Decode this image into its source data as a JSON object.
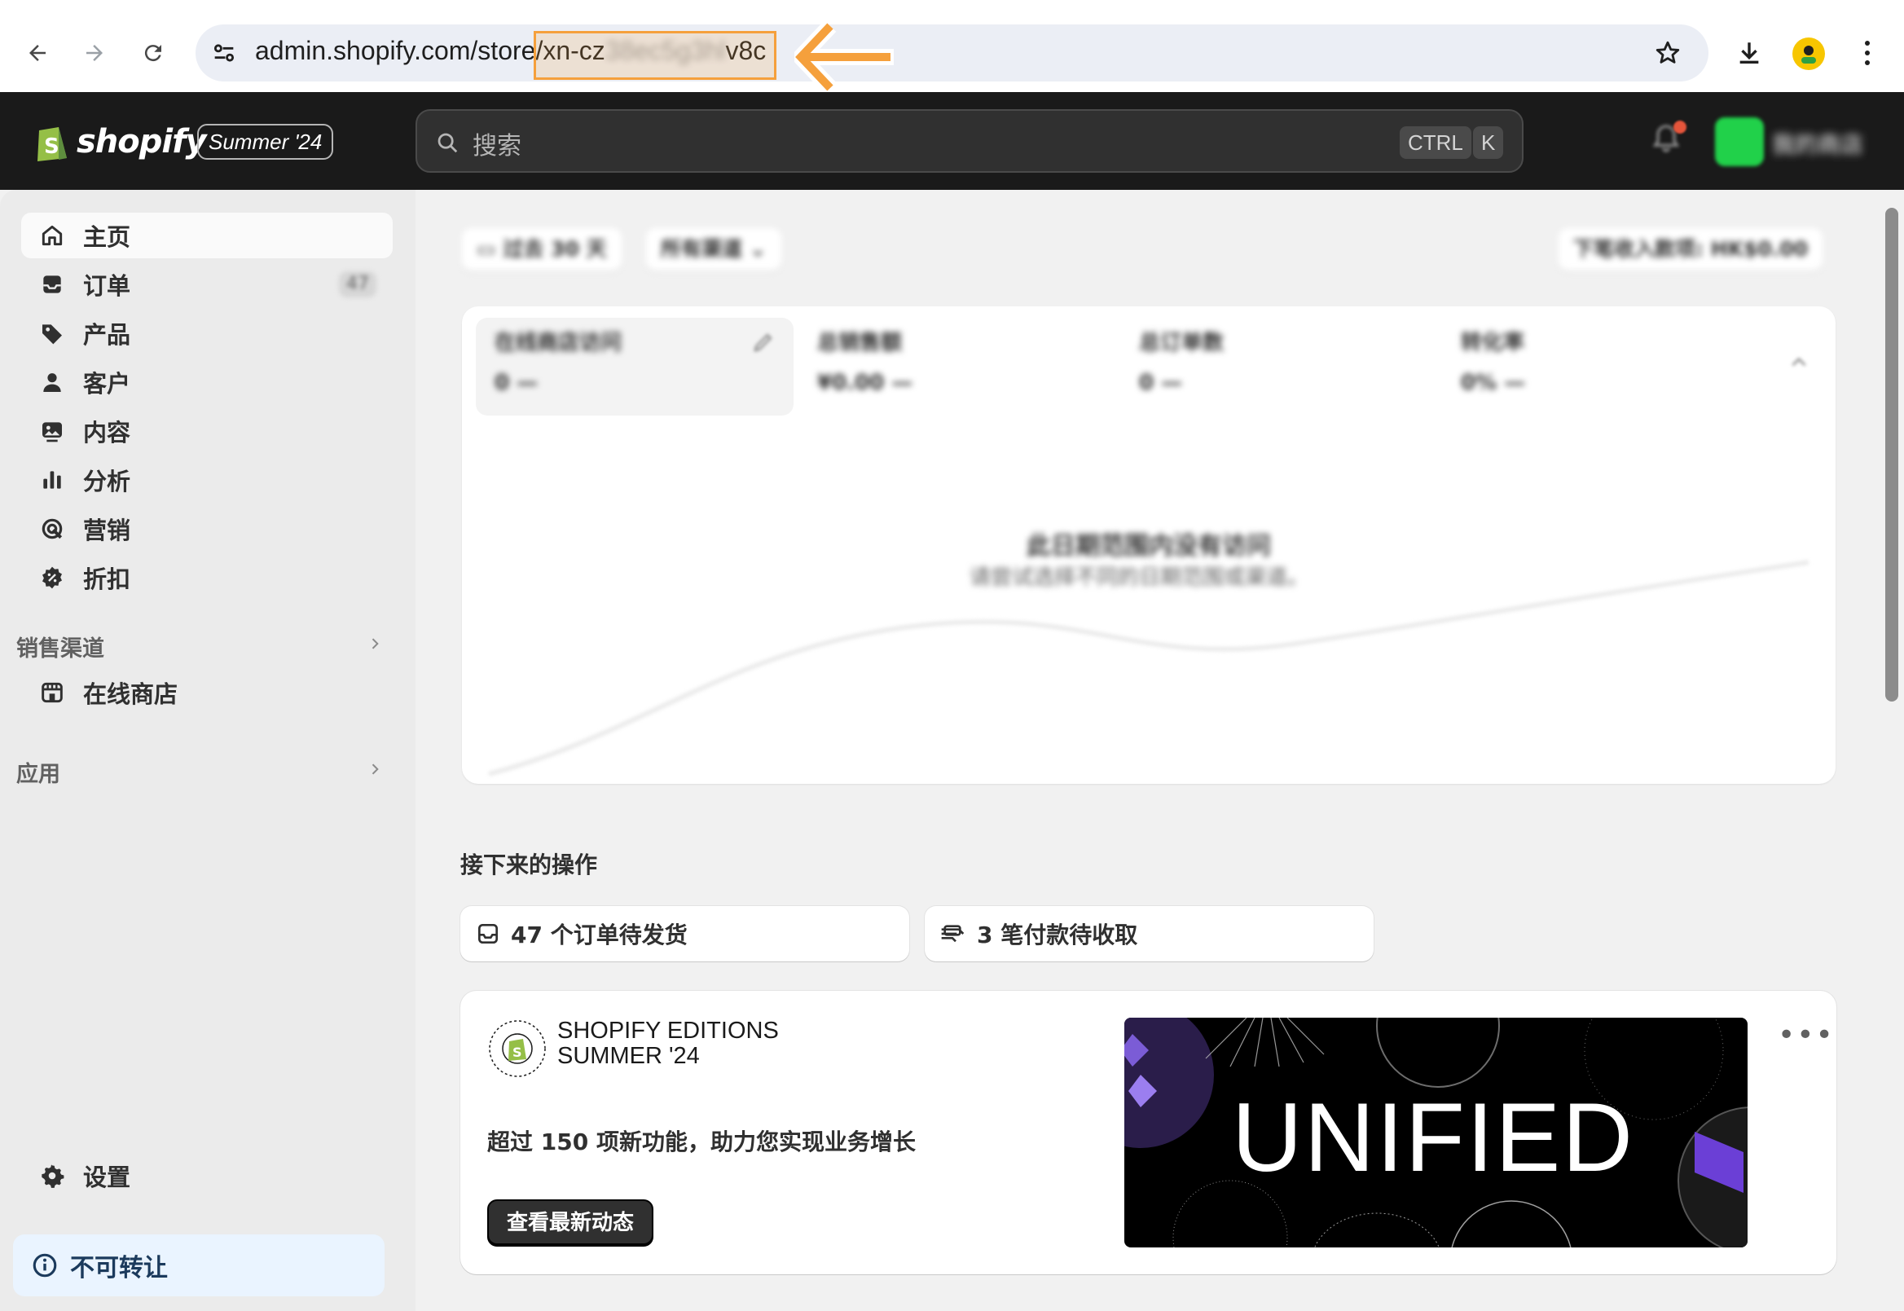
{
  "browser": {
    "url_prefix": "admin.shopify.com/store/",
    "url_store_start": "xn-cz",
    "url_store_hidden": "38ec5g3hl",
    "url_store_end": "v8c"
  },
  "topbar": {
    "brand": "shopify",
    "edition_badge": "Summer '24",
    "search_placeholder": "搜索",
    "shortcut_ctrl": "CTRL",
    "shortcut_key": "K",
    "store_name": "我的商店"
  },
  "sidebar": {
    "items": [
      {
        "label": "主页",
        "icon": "home-icon"
      },
      {
        "label": "订单",
        "icon": "inbox-icon",
        "badge": "47"
      },
      {
        "label": "产品",
        "icon": "tag-icon"
      },
      {
        "label": "客户",
        "icon": "person-icon"
      },
      {
        "label": "内容",
        "icon": "image-icon"
      },
      {
        "label": "分析",
        "icon": "bar-chart-icon"
      },
      {
        "label": "营销",
        "icon": "target-icon"
      },
      {
        "label": "折扣",
        "icon": "discount-icon"
      }
    ],
    "sales_channels_label": "销售渠道",
    "online_store_label": "在线商店",
    "apps_label": "应用",
    "settings_label": "设置",
    "notice_label": "不可转让"
  },
  "filters": {
    "date_range": "过去 30 天",
    "channels": "所有渠道",
    "pending_income": "下笔收入款项: HK$0.00"
  },
  "metrics": [
    {
      "title": "在线商店访问",
      "value": "0 —"
    },
    {
      "title": "总销售额",
      "value": "¥0.00 —"
    },
    {
      "title": "总订单数",
      "value": "0 —"
    },
    {
      "title": "转化率",
      "value": "0% —"
    }
  ],
  "empty_state": {
    "title": "此日期范围内没有访问",
    "subtitle": "请尝试选择不同的日期范围或渠道。"
  },
  "next_actions": {
    "title": "接下来的操作",
    "orders_to_fulfill": "47 个订单待发货",
    "payments_to_capture": "3 笔付款待收取"
  },
  "promo": {
    "brand_line1": "SHOPIFY EDITIONS",
    "brand_line2": "SUMMER '24",
    "headline": "超过 150 项新功能，助力您实现业务增长",
    "cta": "查看最新动态",
    "image_text": "UNIFIED",
    "menu": "•••"
  },
  "colors": {
    "accent_highlight": "#f5a03c",
    "topbar_bg": "#1a1a1a",
    "notice_bg": "#eaf4ff",
    "brand_green": "#95bf47"
  }
}
